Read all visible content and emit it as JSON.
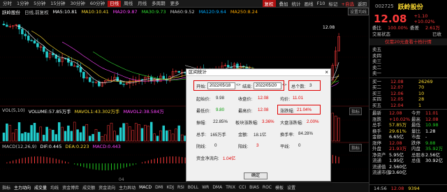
{
  "toolbar": {
    "tabs": [
      "分时",
      "1分钟",
      "5分钟",
      "15分钟",
      "30分钟",
      "60分钟",
      "日线",
      "周线",
      "月线",
      "多周期",
      "更多"
    ],
    "active_tab": "日线",
    "right_items": [
      "复权",
      "叠加",
      "统计",
      "画线",
      "F10",
      "标记",
      "+自选",
      "返回"
    ],
    "red_item": "复权"
  },
  "infobar": {
    "title": "跃岭股份",
    "period": "日线,前复权",
    "ma5": "MA5:10.81",
    "ma10": "MA10:10.41",
    "ma20": "MA20:9.87",
    "ma30": "MA30:9.73",
    "ma60": "MA60:9.52",
    "ma120": "MA120:9.64",
    "ma250": "MA250:8.24",
    "right_label": "设置均线"
  },
  "chart": {
    "price_high_label": "12.08",
    "vol_label": "VOL(5,10)",
    "volume": "VOLUME:57.85万手",
    "mavol1": "MAVOL1:43.302万手",
    "mavol2": "MAVOL2:38.584万",
    "macd_label": "MACD(12,26,9)",
    "dif": "DIF:0.445",
    "dea": "DEA:0.223",
    "macd": "MACD:0.443",
    "pane_btn": "指标",
    "date_axis_label": "04"
  },
  "bottombar": {
    "items": [
      "指标",
      "主力动向",
      "成交量",
      "均线",
      "资金博弈",
      "成交额",
      "资金流向",
      "主力异动",
      "MACD",
      "DMI",
      "KDJ",
      "RSI",
      "BOLL",
      "WR",
      "DMA",
      "TRIX",
      "CCI",
      "BIAS",
      "ROC",
      "模板",
      "设置"
    ],
    "highlight": [
      "主力动向",
      "成交量",
      "MACD"
    ]
  },
  "right_panel": {
    "code": "002725",
    "name": "跃岭股份",
    "price": "12.08",
    "change": "+1.10",
    "change_pct": "+10.02%",
    "rows_top": [
      {
        "label": "委比",
        "value": "100.00%",
        "label2": "委差",
        "value2": "2.61万"
      },
      {
        "label": "交易状态",
        "value": "",
        "label2": "",
        "value2": "已收"
      }
    ],
    "notice": "仅需20元查看十档行情",
    "sells": [
      {
        "label": "卖五",
        "price": "",
        "vol": ""
      },
      {
        "label": "卖四",
        "price": "",
        "vol": ""
      },
      {
        "label": "卖三",
        "price": "",
        "vol": ""
      },
      {
        "label": "卖二",
        "price": "",
        "vol": ""
      },
      {
        "label": "卖一",
        "price": "",
        "vol": ""
      }
    ],
    "buys": [
      {
        "label": "买一",
        "price": "12.08",
        "vol": "26269"
      },
      {
        "label": "买二",
        "price": "12.07",
        "vol": "70"
      },
      {
        "label": "买三",
        "price": "12.06",
        "vol": "10"
      },
      {
        "label": "买四",
        "price": "12.05",
        "vol": "28"
      },
      {
        "label": "买五",
        "price": "12.04",
        "vol": "1"
      }
    ],
    "stats": [
      {
        "l1": "最新",
        "v1": "12.08",
        "c1": "red",
        "l2": "今开",
        "v2": "11.01",
        "c2": "red"
      },
      {
        "l1": "涨跌",
        "v1": "+10.02%",
        "c1": "red",
        "l2": "最高",
        "v2": "12.08",
        "c2": "red"
      },
      {
        "l1": "总手",
        "v1": "57.85万",
        "c1": "yellow",
        "l2": "最低",
        "v2": "10.98",
        "c2": "green"
      },
      {
        "l1": "换手",
        "v1": "29.61%",
        "c1": "yellow",
        "l2": "量比",
        "v2": "1.28",
        "c2": "white"
      },
      {
        "l1": "金额",
        "v1": "6.65亿",
        "c1": "white",
        "l2": "市盈",
        "v2": "-",
        "c2": "white"
      },
      {
        "l1": "涨停",
        "v1": "12.08",
        "c1": "red",
        "l2": "跌停",
        "v2": "9.88",
        "c2": "green"
      },
      {
        "l1": "外盘",
        "v1": "21.93万",
        "c1": "red",
        "l2": "内盘",
        "v2": "35.92万",
        "c2": "green"
      },
      {
        "l1": "净资产",
        "v1": "5.95亿",
        "c1": "white",
        "l2": "总股本",
        "v2": "2.56亿",
        "c2": "white"
      },
      {
        "l1": "流通",
        "v1": "1.95亿",
        "c1": "white",
        "l2": "总值",
        "v2": "30.92亿",
        "c2": "white"
      },
      {
        "l1": "流通值",
        "v1": "2.560亿",
        "c1": "white",
        "l2": "",
        "v2": "",
        "c2": "white"
      },
      {
        "l1": "流通市值",
        "v1": "23.60亿",
        "c1": "white",
        "l2": "",
        "v2": "",
        "c2": "white"
      }
    ],
    "time": "14:56",
    "time_price": "12.08",
    "time_vol": "9394"
  },
  "dialog": {
    "title": "区间统计",
    "start_label": "开始:",
    "start_value": "2022/05/18",
    "end_label": "结束:",
    "end_value": "2022/05/20",
    "days_label": "总个数:",
    "days_value": "3",
    "start_price_label": "起始价:",
    "start_price": "9.98",
    "close_price_label": "收盘价:",
    "close_price": "12.08",
    "avg_label": "均价:",
    "avg": "11.01",
    "low_label": "最低价:",
    "low": "9.80",
    "high_label": "最高价:",
    "high": "12.08",
    "change_label": "涨跌幅:",
    "change": "21.04%",
    "amp_label": "振幅:",
    "amp": "22.85%",
    "sector_label": "板块涨跌幅:",
    "sector": "3.36%",
    "market_label": "大盘涨跌幅:",
    "market": "2.00%",
    "total_vol_label": "总手:",
    "total_vol": "165万手",
    "amount_label": "金额:",
    "amount": "18.1亿",
    "turnover_label": "换手率:",
    "turnover": "84.28%",
    "yin_label": "阴线:",
    "yin": "0",
    "yang_label": "阳线:",
    "yang": "3",
    "flat_label": "平线:",
    "flat": "0",
    "netflow_label": "资金净流向:",
    "netflow": "1.04亿",
    "ok": "确定"
  },
  "colors": {
    "up": "#ff3b3b",
    "down": "#22cc22",
    "ma5": "#ffffff",
    "ma10": "#ffdd33",
    "ma20": "#ff44ff",
    "ma30": "#33dd33",
    "ma60": "#cccccc",
    "ma120": "#00aaff",
    "ma250": "#ffaa00",
    "highlight_box": "#e00000",
    "active_tab": "#b01010"
  }
}
